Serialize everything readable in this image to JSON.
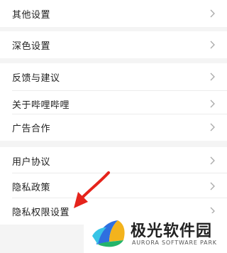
{
  "settings": {
    "group1": [
      {
        "label": "其他设置"
      }
    ],
    "group2": [
      {
        "label": "深色设置"
      }
    ],
    "group3": [
      {
        "label": "反馈与建议"
      },
      {
        "label": "关于哔哩哔哩"
      },
      {
        "label": "广告合作"
      }
    ],
    "group4": [
      {
        "label": "用户协议"
      },
      {
        "label": "隐私政策"
      },
      {
        "label": "隐私权限设置"
      }
    ]
  },
  "watermark": {
    "title": "极光软件园",
    "subtitle": "AURORA SOFTWARE PARK"
  },
  "colors": {
    "background": "#f4f4f4",
    "row": "#ffffff",
    "chevron": "#a9a9a9",
    "arrow": "#e5231b"
  },
  "icons": {
    "chevron": "chevron-right-icon",
    "arrow": "annotation-arrow",
    "logo": "aurora-logo"
  }
}
